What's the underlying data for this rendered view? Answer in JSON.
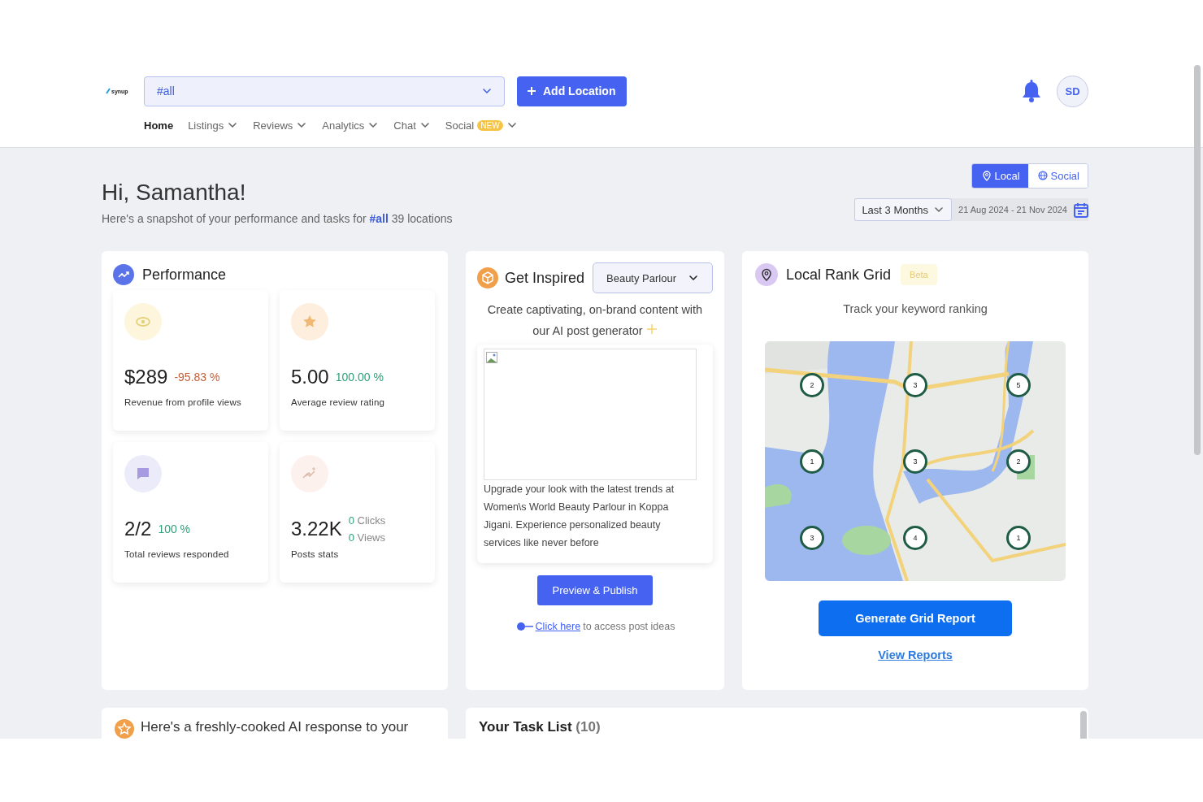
{
  "header": {
    "logo": "synup",
    "location_select": {
      "value": "#all"
    },
    "add_button": "Add Location",
    "avatar": "SD"
  },
  "nav": [
    {
      "label": "Home",
      "selected": true,
      "has_menu": false
    },
    {
      "label": "Listings",
      "selected": false,
      "has_menu": true
    },
    {
      "label": "Reviews",
      "selected": false,
      "has_menu": true
    },
    {
      "label": "Analytics",
      "selected": false,
      "has_menu": true
    },
    {
      "label": "Chat",
      "selected": false,
      "has_menu": true
    },
    {
      "label": "Social",
      "selected": false,
      "has_menu": true,
      "badge": "NEW"
    }
  ],
  "greeting": "Hi, Samantha!",
  "subtitle": "Here's a snapshot of your performance and tasks for **#all** 39 locations",
  "view_toggle": [
    {
      "label": "Local",
      "selected": true,
      "kind": "pin"
    },
    {
      "label": "Social",
      "selected": false,
      "kind": "globe"
    }
  ],
  "period_select": "Last 3 Months",
  "date_range": "21 Aug 2024 - 21 Nov 2024",
  "performance": {
    "title": "Performance",
    "stats": [
      {
        "kind": "eye",
        "value": "$289",
        "change": "-95.83 %",
        "negative": true,
        "label": "Revenue from profile views"
      },
      {
        "kind": "star",
        "value": "5.00",
        "change": "100.00 %",
        "negative": false,
        "label": "Average review rating"
      },
      {
        "kind": "chat",
        "value": "2/2",
        "change": "100 %",
        "negative": false,
        "label": "Total reviews responded"
      },
      {
        "kind": "posts",
        "value": "3.22K",
        "breakdown": [
          {
            "count": "0",
            "label": "Clicks"
          },
          {
            "count": "0",
            "label": "Views"
          }
        ],
        "label": "Posts stats"
      }
    ]
  },
  "inspire": {
    "title": "Get Inspired",
    "category_select": "Beauty Parlour",
    "intro": "Create captivating, on-brand content with our AI post generator",
    "post_text": "Upgrade your look with the latest trends at Women\\s World Beauty Parlour in Koppa Jigani. Experience personalized beauty services like never before",
    "publish_button": "Preview & Publish",
    "hint_link": "Click here",
    "hint_text": "to access post ideas"
  },
  "rank_grid": {
    "title": "Local Rank Grid",
    "badge": "Beta",
    "subtitle": "Track your keyword ranking",
    "markers": [
      {
        "rank": "2"
      },
      {
        "rank": "3"
      },
      {
        "rank": "5"
      },
      {
        "rank": "1"
      },
      {
        "rank": "3"
      },
      {
        "rank": "2"
      },
      {
        "rank": "3"
      },
      {
        "rank": "4"
      },
      {
        "rank": "1"
      }
    ],
    "generate_button": "Generate Grid Report",
    "view_reports_link": "View Reports"
  },
  "ai_response": {
    "title": "Here's a freshly-cooked AI response to your"
  },
  "task_list": {
    "title": "Your Task List",
    "count": "(10)"
  }
}
